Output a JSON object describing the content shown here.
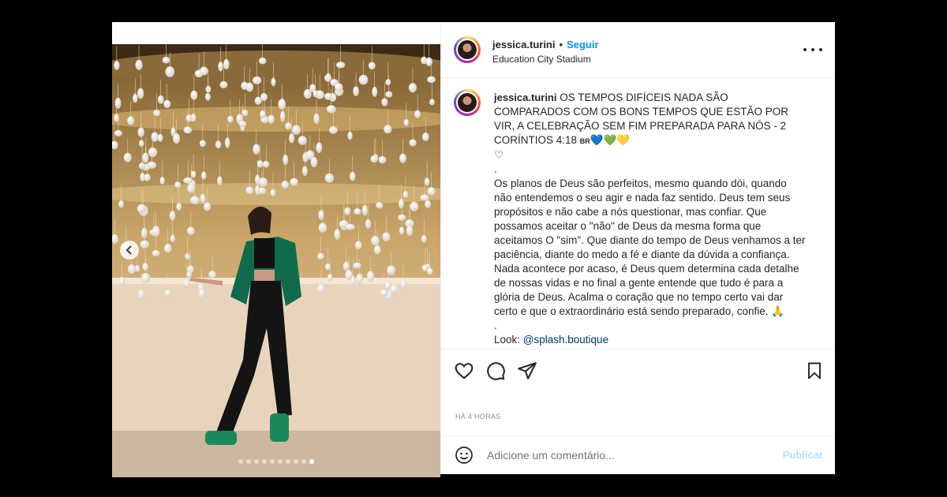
{
  "post": {
    "username": "jessica.turini",
    "separator": "•",
    "follow_label": "Seguir",
    "location": "Education City Stadium"
  },
  "caption": {
    "username": "jessica.turini",
    "lead": "OS TEMPOS DIFÍCEIS NADA SÃO COMPARADOS COM OS BONS TEMPOS QUE ESTÃO POR VIR, A CELEBRAÇÃO SEM FIM PREPARADA PARA NÓS - 2 CORÍNTIOS 4:18",
    "flag_emoji": "BR",
    "hearts": "💙💚💛",
    "heart2": "♡",
    "dot1": ".",
    "body": "Os planos de Deus são perfeitos, mesmo quando dói, quando não entendemos o seu agir e nada faz sentido. Deus tem seus propósitos e não cabe a nós questionar, mas confiar. Que possamos aceitar o \"não\" de Deus da mesma forma que aceitamos O \"sim\". Que diante do tempo de Deus venhamos a ter paciência, diante do medo a fé e diante da dúvida a confiança. Nada acontece por acaso, é Deus quem determina cada detalhe de nossas vidas e no final a gente entende que tudo é para a glória de Deus. Acalma o coração que no tempo certo vai dar certo e que o extraordinário está sendo preparado, confie. 🙏",
    "dot2": ".",
    "look_label": "Look:",
    "look_link": "@splash.boutique"
  },
  "meta": {
    "time_ago": "HÁ 4 HORAS"
  },
  "comment": {
    "placeholder": "Adicione um comentário...",
    "publish_label": "Publicar"
  },
  "carousel": {
    "total": 10,
    "active_index": 9
  },
  "icons": {
    "like": "heart-icon",
    "comment": "comment-icon",
    "share": "send-icon",
    "save": "bookmark-icon",
    "emoji": "emoji-icon",
    "more": "more-icon",
    "prev": "chevron-left-icon"
  },
  "colors": {
    "link_blue": "#0095f6",
    "publish_disabled": "#b2dffc",
    "text": "#262626",
    "muted": "#8e8e8e"
  }
}
